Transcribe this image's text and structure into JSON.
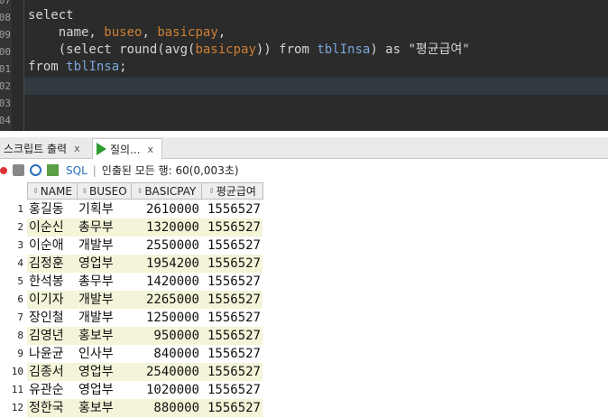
{
  "editor": {
    "line_numbers": [
      "07",
      "08",
      "09",
      "00",
      "01",
      "02",
      "03",
      "04"
    ],
    "line1": "select",
    "line2_a": "    name, ",
    "line2_col1": "buseo",
    "line2_b": ", ",
    "line2_col2": "basicpay",
    "line2_c": ",",
    "line3_a": "    (select round(avg(",
    "line3_col": "basicpay",
    "line3_b": ")) from ",
    "line3_tbl": "tblInsa",
    "line3_c": ") as \"평균급여\"",
    "line4_a": "from ",
    "line4_tbl": "tblInsa",
    "line4_b": ";"
  },
  "tabs": {
    "tab1_label": "스크립트 출력",
    "tab1_close": "x",
    "tab2_label": "질의...",
    "tab2_close": "x"
  },
  "toolbar": {
    "sql_label": "SQL",
    "sep": "|",
    "status": "인출된 모든 행: 60(0,003초)"
  },
  "grid": {
    "columns": [
      "NAME",
      "BUSEO",
      "BASICPAY",
      "평균급여"
    ],
    "rows": [
      {
        "n": "1",
        "name": "홍길동",
        "buseo": "기획부",
        "pay": "2610000",
        "avg": "1556527"
      },
      {
        "n": "2",
        "name": "이순신",
        "buseo": "총무부",
        "pay": "1320000",
        "avg": "1556527"
      },
      {
        "n": "3",
        "name": "이순애",
        "buseo": "개발부",
        "pay": "2550000",
        "avg": "1556527"
      },
      {
        "n": "4",
        "name": "김정훈",
        "buseo": "영업부",
        "pay": "1954200",
        "avg": "1556527"
      },
      {
        "n": "5",
        "name": "한석봉",
        "buseo": "총무부",
        "pay": "1420000",
        "avg": "1556527"
      },
      {
        "n": "6",
        "name": "이기자",
        "buseo": "개발부",
        "pay": "2265000",
        "avg": "1556527"
      },
      {
        "n": "7",
        "name": "장인철",
        "buseo": "개발부",
        "pay": "1250000",
        "avg": "1556527"
      },
      {
        "n": "8",
        "name": "김영년",
        "buseo": "홍보부",
        "pay": "950000",
        "avg": "1556527"
      },
      {
        "n": "9",
        "name": "나윤균",
        "buseo": "인사부",
        "pay": "840000",
        "avg": "1556527"
      },
      {
        "n": "10",
        "name": "김종서",
        "buseo": "영업부",
        "pay": "2540000",
        "avg": "1556527"
      },
      {
        "n": "11",
        "name": "유관순",
        "buseo": "영업부",
        "pay": "1020000",
        "avg": "1556527"
      },
      {
        "n": "12",
        "name": "정한국",
        "buseo": "홍보부",
        "pay": "880000",
        "avg": "1556527"
      }
    ]
  }
}
